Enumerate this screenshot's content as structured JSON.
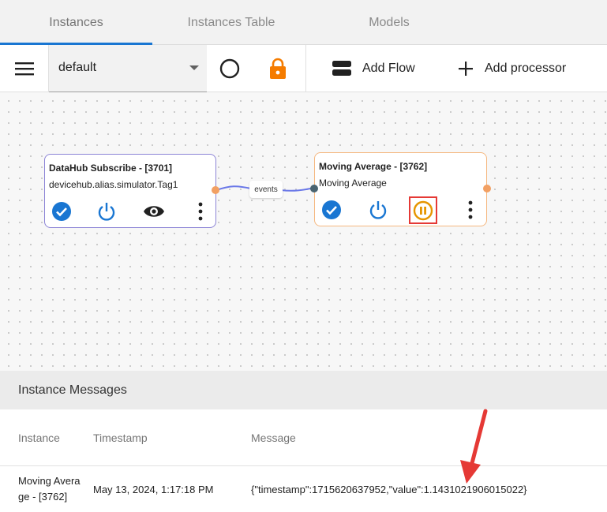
{
  "tabs": [
    {
      "label": "Instances"
    },
    {
      "label": "Instances Table"
    },
    {
      "label": "Models"
    }
  ],
  "toolbar": {
    "flow_select_value": "default",
    "add_flow_label": "Add Flow",
    "add_processor_label": "Add processor"
  },
  "canvas": {
    "nodes": [
      {
        "title": "DataHub Subscribe - [3701]",
        "subtitle": "devicehub.alias.simulator.Tag1"
      },
      {
        "title": "Moving Average - [3762]",
        "subtitle": "Moving Average"
      }
    ],
    "edge_label": "events"
  },
  "messages": {
    "title": "Instance Messages",
    "columns": [
      "Instance",
      "Timestamp",
      "Message"
    ],
    "rows": [
      {
        "instance_line1": "Moving Avera",
        "instance_line2": "ge - [3762]",
        "timestamp": "May 13, 2024, 1:17:18 PM",
        "message": "{\"timestamp\":1715620637952,\"value\":1.1431021906015022}"
      }
    ]
  },
  "colors": {
    "accent_blue": "#1976d2",
    "lock_orange": "#f57c00",
    "pause_orange": "#e69500",
    "highlight_red": "#e53935",
    "edge_line": "#6a78e8"
  }
}
